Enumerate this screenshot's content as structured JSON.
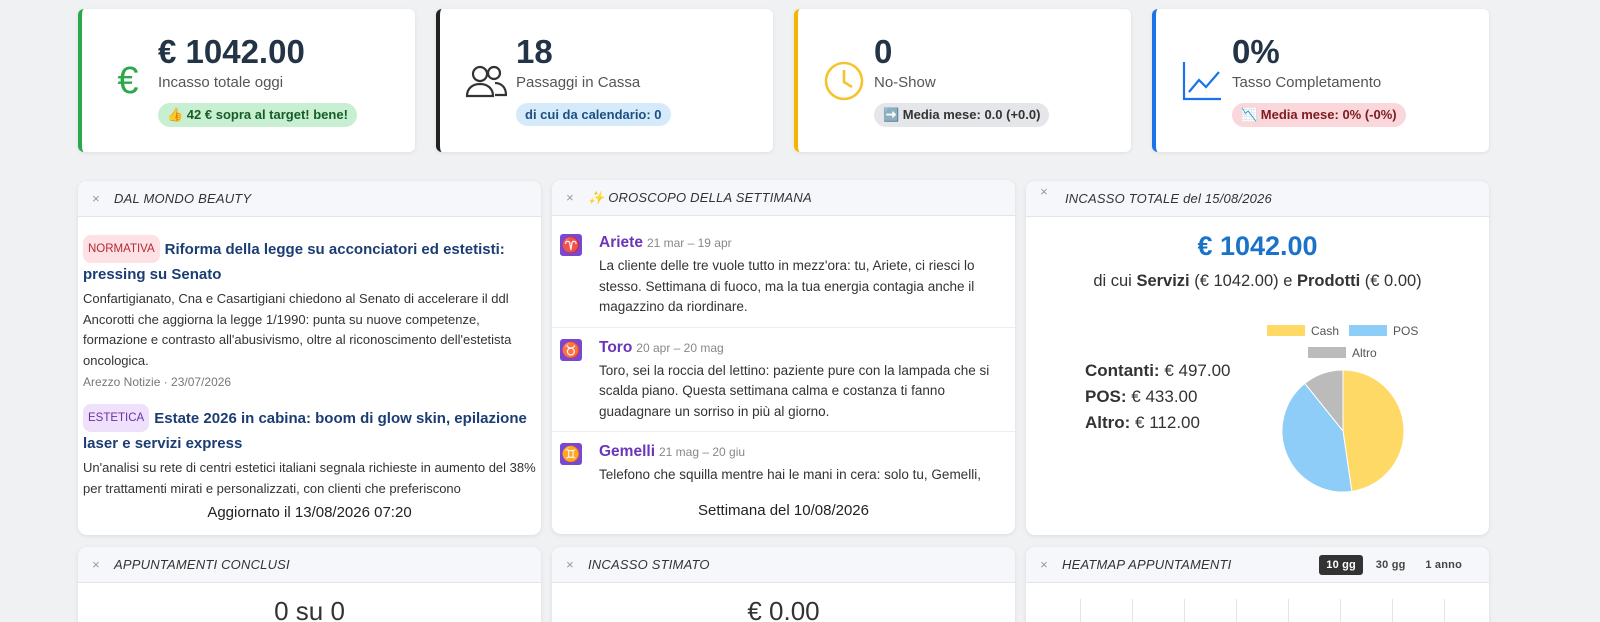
{
  "stats": [
    {
      "value": "€ 1042.00",
      "label": "Incasso totale oggi",
      "badge": "👍 42 € sopra al target! bene!",
      "accent": "#2aa84a",
      "icon": "euro-icon"
    },
    {
      "value": "18",
      "label": "Passaggi in Cassa",
      "badge": "di cui da calendario: 0",
      "accent": "#222222",
      "icon": "users-icon"
    },
    {
      "value": "0",
      "label": "No-Show",
      "badge": "➡️ Media mese: 0.0 (+0.0)",
      "accent": "#f4b400",
      "icon": "clock-icon"
    },
    {
      "value": "0%",
      "label": "Tasso Completamento",
      "badge": "📉 Media mese: 0% (-0%)",
      "accent": "#1a73e8",
      "icon": "chart-line-icon"
    }
  ],
  "news": {
    "title": "DAL MONDO BEAUTY",
    "items": [
      {
        "tag": "NORMATIVA",
        "title": "Riforma della legge su acconciatori ed estetisti: pressing su Senato",
        "body": "Confartigianato, Cna e Casartigiani chiedono al Senato di accelerare il ddl Ancorotti che aggiorna la legge 1/1990: punta su nuove competenze, formazione e contrasto all'abusivismo, oltre al riconoscimento dell'estetista oncologica.",
        "meta": "Arezzo Notizie · 23/07/2026"
      },
      {
        "tag": "ESTETICA",
        "title": "Estate 2026 in cabina: boom di glow skin, epilazione laser e servizi express",
        "body": "Un'analisi su rete di centri estetici italiani segnala richieste in aumento del 38% per trattamenti mirati e personalizzati, con clienti che preferiscono",
        "meta": ""
      }
    ],
    "footer": "Aggiornato il 13/08/2026 07:20"
  },
  "horoscope": {
    "title": "✨ OROSCOPO DELLA SETTIMANA",
    "signs": [
      {
        "symbol": "♈",
        "name": "Ariete",
        "dates": "21 mar – 19 apr",
        "text": "La cliente delle tre vuole tutto in mezz'ora: tu, Ariete, ci riesci lo stesso. Settimana di fuoco, ma la tua energia contagia anche il magazzino da riordinare."
      },
      {
        "symbol": "♉",
        "name": "Toro",
        "dates": "20 apr – 20 mag",
        "text": "Toro, sei la roccia del lettino: paziente pure con la lampada che si scalda piano. Questa settimana calma e costanza ti fanno guadagnare un sorriso in più al giorno."
      },
      {
        "symbol": "♊",
        "name": "Gemelli",
        "dates": "21 mag – 20 giu",
        "text": "Telefono che squilla mentre hai le mani in cera: solo tu, Gemelli,"
      }
    ],
    "footer": "Settimana del 10/08/2026"
  },
  "income": {
    "title": "INCASSO TOTALE del  15/08/2026",
    "total": "€ 1042.00",
    "summary_prefix": "di cui ",
    "services_label": "Servizi",
    "services_value": " (€ 1042.00) e ",
    "products_label": "Prodotti",
    "products_value": " (€ 0.00)",
    "breakdown": [
      {
        "label": "Contanti:",
        "value": " € 497.00"
      },
      {
        "label": "POS:",
        "value": " € 433.00"
      },
      {
        "label": "Altro:",
        "value": " € 112.00"
      }
    ]
  },
  "chart_data": {
    "type": "pie",
    "series": [
      {
        "name": "Cash",
        "value": 497.0,
        "color": "#ffd966"
      },
      {
        "name": "POS",
        "value": 433.0,
        "color": "#8ecdf7"
      },
      {
        "name": "Altro",
        "value": 112.0,
        "color": "#bbbbbb"
      }
    ],
    "legend": "top"
  },
  "bottom": {
    "appointments_title": "APPUNTAMENTI CONCLUSI",
    "appointments_value": "0 su 0",
    "estimated_title": "INCASSO STIMATO",
    "estimated_value": "€ 0.00",
    "heatmap_title": "HEATMAP APPUNTAMENTI",
    "ranges": [
      "10 gg",
      "30 gg",
      "1 anno"
    ]
  }
}
